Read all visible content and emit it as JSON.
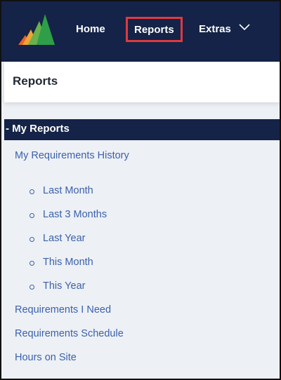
{
  "nav": {
    "home": "Home",
    "reports": "Reports",
    "extras": "Extras"
  },
  "colors": {
    "navbar": "#142347",
    "active_outline": "#e0393f",
    "link": "#3a62ac",
    "panel": "#edf0f5"
  },
  "icons": {
    "logo": "logo-mountain-icon",
    "extras_dropdown": "chevron-down-icon",
    "list_bullet": "circle-bullet-icon"
  },
  "header": {
    "title": "Reports"
  },
  "section": {
    "title": "My Reports"
  },
  "links": {
    "history": "My Requirements History",
    "history_items": [
      "Last Month",
      "Last 3 Months",
      "Last Year",
      "This Month",
      "This Year"
    ],
    "need": "Requirements I Need",
    "schedule": "Requirements Schedule",
    "hours": "Hours on Site"
  }
}
